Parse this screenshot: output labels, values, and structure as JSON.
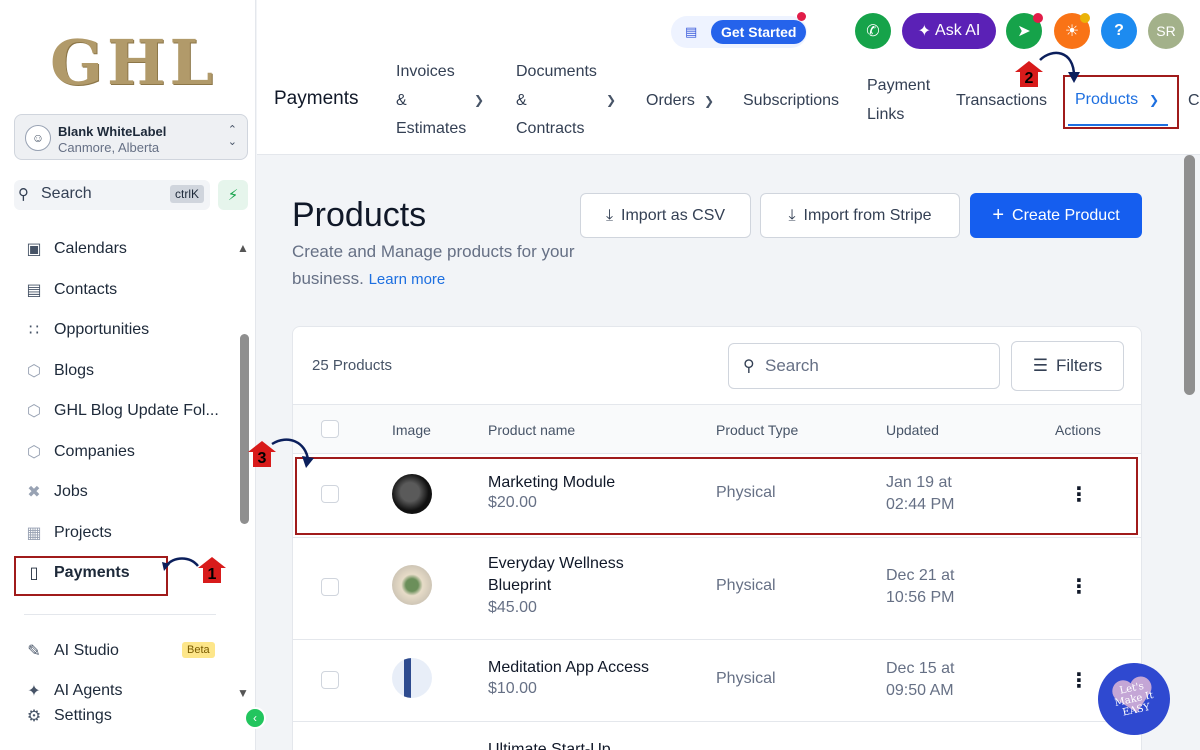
{
  "sidebar": {
    "logo": "GHL",
    "account": {
      "name": "Blank WhiteLabel",
      "location": "Canmore, Alberta"
    },
    "search": {
      "label": "Search",
      "shortcut": "ctrlK"
    },
    "items": [
      {
        "label": "Calendars",
        "icon": "calendar-icon"
      },
      {
        "label": "Contacts",
        "icon": "contacts-icon"
      },
      {
        "label": "Opportunities",
        "icon": "opportunities-icon"
      },
      {
        "label": "Blogs",
        "icon": "blogs-icon"
      },
      {
        "label": "GHL Blog Update Fol...",
        "icon": "folder-icon"
      },
      {
        "label": "Companies",
        "icon": "companies-icon"
      },
      {
        "label": "Jobs",
        "icon": "jobs-icon"
      },
      {
        "label": "Projects",
        "icon": "projects-icon"
      },
      {
        "label": "Payments",
        "icon": "payments-icon"
      }
    ],
    "bottom_items": [
      {
        "label": "AI Studio",
        "badge": "Beta"
      },
      {
        "label": "AI Agents"
      },
      {
        "label": "Settings"
      }
    ]
  },
  "topbar": {
    "get_started": "Get Started",
    "ask_ai": "Ask AI",
    "avatar_initials": "SR",
    "help": "?"
  },
  "tabs": {
    "title": "Payments",
    "invoices": [
      "Invoices",
      "&",
      "Estimates"
    ],
    "documents": [
      "Documents",
      "&",
      "Contracts"
    ],
    "orders": "Orders",
    "subscriptions": "Subscriptions",
    "payment_links": [
      "Payment",
      "Links"
    ],
    "transactions": "Transactions",
    "products": "Products",
    "overflow": "C"
  },
  "page": {
    "title": "Products",
    "subtitle": "Create and Manage products for your business.",
    "learn_more": "Learn more",
    "import_csv": "Import as CSV",
    "import_stripe": "Import from Stripe",
    "create": "Create Product"
  },
  "table": {
    "count": "25 Products",
    "search_placeholder": "Search",
    "filters": "Filters",
    "columns": [
      "Image",
      "Product name",
      "Product Type",
      "Updated",
      "Actions"
    ],
    "rows": [
      {
        "name": "Marketing Module",
        "price": "$20.00",
        "type": "Physical",
        "date_line1": "Jan 19 at",
        "date_line2": "02:44 PM"
      },
      {
        "name": "Everyday Wellness Blueprint",
        "price": "$45.00",
        "type": "Physical",
        "date_line1": "Dec 21 at",
        "date_line2": "10:56 PM"
      },
      {
        "name": "Meditation App Access",
        "price": "$10.00",
        "type": "Physical",
        "date_line1": "Dec 15 at",
        "date_line2": "09:50 AM"
      },
      {
        "name": "Ultimate Start-Up",
        "price": "",
        "type": "",
        "date_line1": "",
        "date_line2": ""
      }
    ]
  },
  "annotations": {
    "step1": "1",
    "step2": "2",
    "step3": "3"
  },
  "watermark": "Let's Make It EASY",
  "colors": {
    "accent": "#155eef",
    "highlight": "#a01b1b",
    "ai": "#5b21b6",
    "green": "#16a34a"
  }
}
